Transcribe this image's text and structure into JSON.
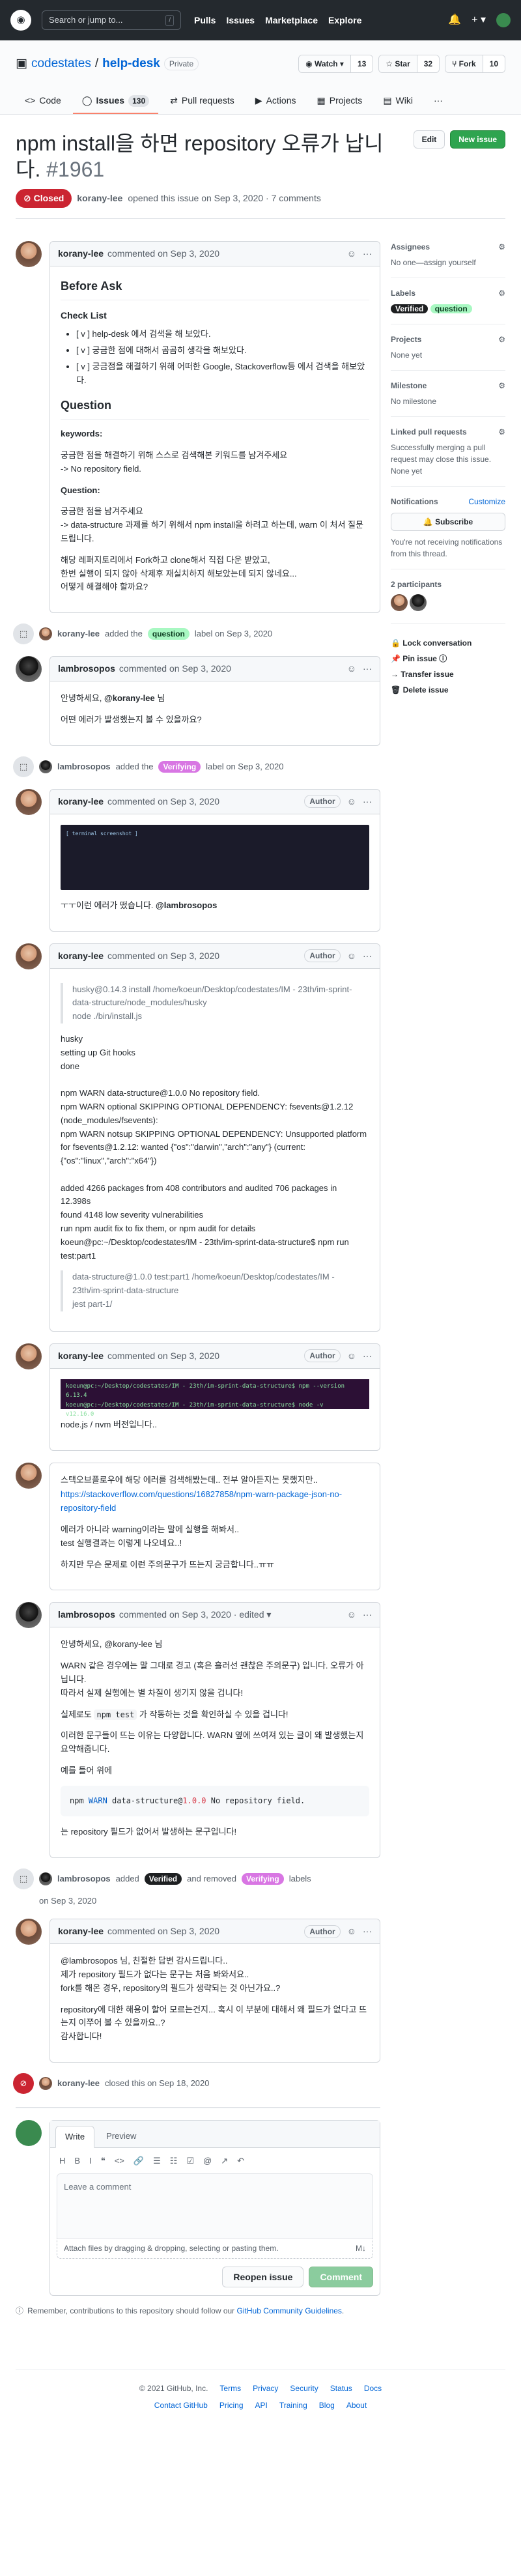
{
  "header": {
    "search_placeholder": "Search or jump to...",
    "slash": "/",
    "nav": [
      "Pulls",
      "Issues",
      "Marketplace",
      "Explore"
    ],
    "bell": "🔔",
    "plus": "+ ▾"
  },
  "repo": {
    "owner": "codestates",
    "sep": "/",
    "name": "help-desk",
    "visibility": "Private",
    "watch_label": "◉ Watch ▾",
    "watch_count": "13",
    "star_label": "☆ Star",
    "star_count": "32",
    "fork_label": "⑂ Fork",
    "fork_count": "10"
  },
  "tabs": [
    {
      "icon": "<>",
      "label": "Code"
    },
    {
      "icon": "◯",
      "label": "Issues",
      "count": "130"
    },
    {
      "icon": "⇄",
      "label": "Pull requests"
    },
    {
      "icon": "▶",
      "label": "Actions"
    },
    {
      "icon": "▦",
      "label": "Projects"
    },
    {
      "icon": "▤",
      "label": "Wiki"
    },
    {
      "icon": "···",
      "label": ""
    }
  ],
  "issue": {
    "title": "npm install을 하면 repository 오류가 납니다.",
    "number": "#1961",
    "edit": "Edit",
    "new_issue": "New issue",
    "status": "⊘ Closed",
    "author": "korany-lee",
    "meta": "opened this issue on Sep 3, 2020 · 7 comments"
  },
  "comments": [
    {
      "author": "korany-lee",
      "when": "commented on Sep 3, 2020",
      "role": "",
      "h_before": "Before Ask",
      "h_check": "Check List",
      "checks": [
        "[ v ] help-desk 에서 검색을 해 보았다.",
        "[ v ] 궁금한 점에 대해서 곰곰히 생각을 해보았다.",
        "[ v ] 궁금점을 해결하기 위해 어떠한 Google, Stackoverflow등 에서 검색을 해보았다."
      ],
      "h_question": "Question",
      "kw_label": "keywords:",
      "kw_text": "궁금한 점을 해결하기 위해 스스로 검색해본 키워드를 남겨주세요\n-> No repository field.",
      "q_label": "Question:",
      "q_text": "궁금한 점을 남겨주세요\n-> data-structure 과제를 하기 위해서 npm install을 하려고 하는데, warn 이 처서 질문드립니다.",
      "q_text2": "해당 레퍼지토리에서 Fork하고 clone해서 직접 다운 받았고,\n한번 실행이 되지 않아 삭제후 재실치하지 해보았는데 되지 않네요...\n어떻게 해결해야 할까요?"
    },
    {
      "author": "lambrosopos",
      "when": "commented on Sep 3, 2020",
      "role": "",
      "greet": "안녕하세요,",
      "mention": "@korany-lee",
      "greet_end": "님",
      "ask": "어떤 에러가 발생했는지 볼 수 있을까요?"
    },
    {
      "author": "korany-lee",
      "when": "commented on Sep 3, 2020",
      "role": "Author",
      "term_text": "[ terminal screenshot ]",
      "body": "ㅜㅜ이런 에러가 떴습니다.",
      "mention": "@lambrosopos"
    },
    {
      "author": "korany-lee",
      "when": "commented on Sep 3, 2020",
      "role": "Author",
      "q1": "husky@0.14.3 install /home/koeun/Desktop/codestates/IM - 23th/im-sprint-data-structure/node_modules/husky\nnode ./bin/install.js",
      "lines": "husky\nsetting up Git hooks\ndone\n\nnpm WARN data-structure@1.0.0 No repository field.\nnpm WARN optional SKIPPING OPTIONAL DEPENDENCY: fsevents@1.2.12 (node_modules/fsevents):\nnpm WARN notsup SKIPPING OPTIONAL DEPENDENCY: Unsupported platform for fsevents@1.2.12: wanted {\"os\":\"darwin\",\"arch\":\"any\"} (current: {\"os\":\"linux\",\"arch\":\"x64\"})\n\nadded 4266 packages from 408 contributors and audited 706 packages in 12.398s\nfound 4148 low severity vulnerabilities\nrun  npm audit fix  to fix them, or  npm audit  for details\nkoeun@pc:~/Desktop/codestates/IM - 23th/im-sprint-data-structure$ npm run test:part1",
      "q2": "data-structure@1.0.0 test:part1 /home/koeun/Desktop/codestates/IM - 23th/im-sprint-data-structure\njest part-1/"
    },
    {
      "author": "korany-lee",
      "when": "commented on Sep 3, 2020",
      "role": "Author",
      "term_line1": "koeun@pc:~/Desktop/codestates/IM - 23th/im-sprint-data-structure$ npm --version",
      "term_line2": "6.13.4",
      "term_line3": "koeun@pc:~/Desktop/codestates/IM - 23th/im-sprint-data-structure$ node -v",
      "term_line4": "v12.16.0",
      "body": "node.js / nvm 버전입니다.."
    },
    {
      "author": "korany-lee",
      "when": "",
      "role": "",
      "p1": "스택오브플로우에 해당 에러를 검색해봤는데.. 전부 알아듣지는 못했지만..",
      "link": "https://stackoverflow.com/questions/16827858/npm-warn-package-json-no-repository-field",
      "p2": "에러가 아니라 warning이라는 말에 실행을 해봐서..\ntest 실행결과는 이렇게 나오네요..!",
      "p3": "하지만 무슨 문제로 이런 주의문구가 뜨는지 궁금합니다..ㅠㅠ"
    },
    {
      "author": "lambrosopos",
      "when": "commented on Sep 3, 2020 · edited ▾",
      "role": "",
      "p1": "안녕하세요, @korany-lee 님",
      "p2": "WARN 같은 경우에는 말 그대로 경고 (혹은 흘러선 괜찮은 주의문구) 입니다. 오류가 아닙니다.\n따라서 실제 실행에는 별 차질이 생기지 않을 겁니다!",
      "p3a": "실제로도",
      "p3code": "npm test",
      "p3b": "가 작동하는 것을 확인하실 수 있을 겁니다!",
      "p4": "이러한 문구들이 뜨는 이유는 다양합니다. WARN 옆에 쓰여져 있는 글이 왜 발생했는지 요약해줍니다.",
      "p5": "예를 들어 위에",
      "code_a": "npm ",
      "code_warn": "WARN",
      "code_b": " data-structure@",
      "code_ver": "1.0.0",
      "code_c": " No repository field.",
      "p6": "는 repository 필드가 없어서 발생하는 문구입니다!"
    },
    {
      "author": "korany-lee",
      "when": "commented on Sep 3, 2020",
      "role": "Author",
      "p1": "@lambrosopos 님, 친절한 답변 감사드립니다..\n제가 repository 필드가 없다는 문구는 처음 봐와서요..\nfork를 해온 경우, repository의 필드가 생략되는 것 아닌가요..?",
      "p2": "repository에 대한 해용이 할어 모르는건지... 혹시 이 부분에 대해서 왜 필드가 없다고 뜨는지 이쭈어 볼 수 있을까요..?\n감사합니다!"
    }
  ],
  "events": {
    "e1_actor": "korany-lee",
    "e1_a": "added the",
    "e1_label": "question",
    "e1_b": "label on Sep 3, 2020",
    "e2_actor": "lambrosopos",
    "e2_a": "added the",
    "e2_label": "Verifying",
    "e2_b": "label on Sep 3, 2020",
    "e3_actor": "lambrosopos",
    "e3_a": "added",
    "e3_label1": "Verified",
    "e3_mid": "and removed",
    "e3_label2": "Verifying",
    "e3_b": "labels",
    "e3_c": "on Sep 3, 2020",
    "e4_actor": "korany-lee",
    "e4_a": "closed this on Sep 18, 2020"
  },
  "sidebar": {
    "assignees": "Assignees",
    "assignees_v": "No one—assign yourself",
    "labels": "Labels",
    "label1": "Verified",
    "label2": "question",
    "projects": "Projects",
    "projects_v": "None yet",
    "milestone": "Milestone",
    "milestone_v": "No milestone",
    "linked": "Linked pull requests",
    "linked_v": "Successfully merging a pull request may close this issue.",
    "linked_v2": "None yet",
    "notif": "Notifications",
    "customize": "Customize",
    "subscribe": "🔔 Subscribe",
    "notif_v": "You're not receiving notifications from this thread.",
    "participants": "2 participants",
    "lock": "🔒 Lock conversation",
    "pin": "📌 Pin issue ⓘ",
    "transfer": "→ Transfer issue",
    "delete": "🗑 Delete issue"
  },
  "form": {
    "write": "Write",
    "preview": "Preview",
    "toolbar": [
      "H",
      "B",
      "I",
      "❝",
      "<>",
      "🔗",
      "☰",
      "☷",
      "☑",
      "@",
      "↗",
      "↶"
    ],
    "placeholder": "Leave a comment",
    "attach": "Attach files by dragging & dropping, selecting or pasting them.",
    "md": "M↓",
    "reopen": "Reopen issue",
    "comment": "Comment",
    "remember": "Remember, contributions to this repository should follow our",
    "guidelines": "GitHub Community Guidelines",
    "dot": "."
  },
  "footer": {
    "row1": [
      "© 2021 GitHub, Inc.",
      "Terms",
      "Privacy",
      "Security",
      "Status",
      "Docs"
    ],
    "row2": [
      "Contact GitHub",
      "Pricing",
      "API",
      "Training",
      "Blog",
      "About"
    ]
  }
}
